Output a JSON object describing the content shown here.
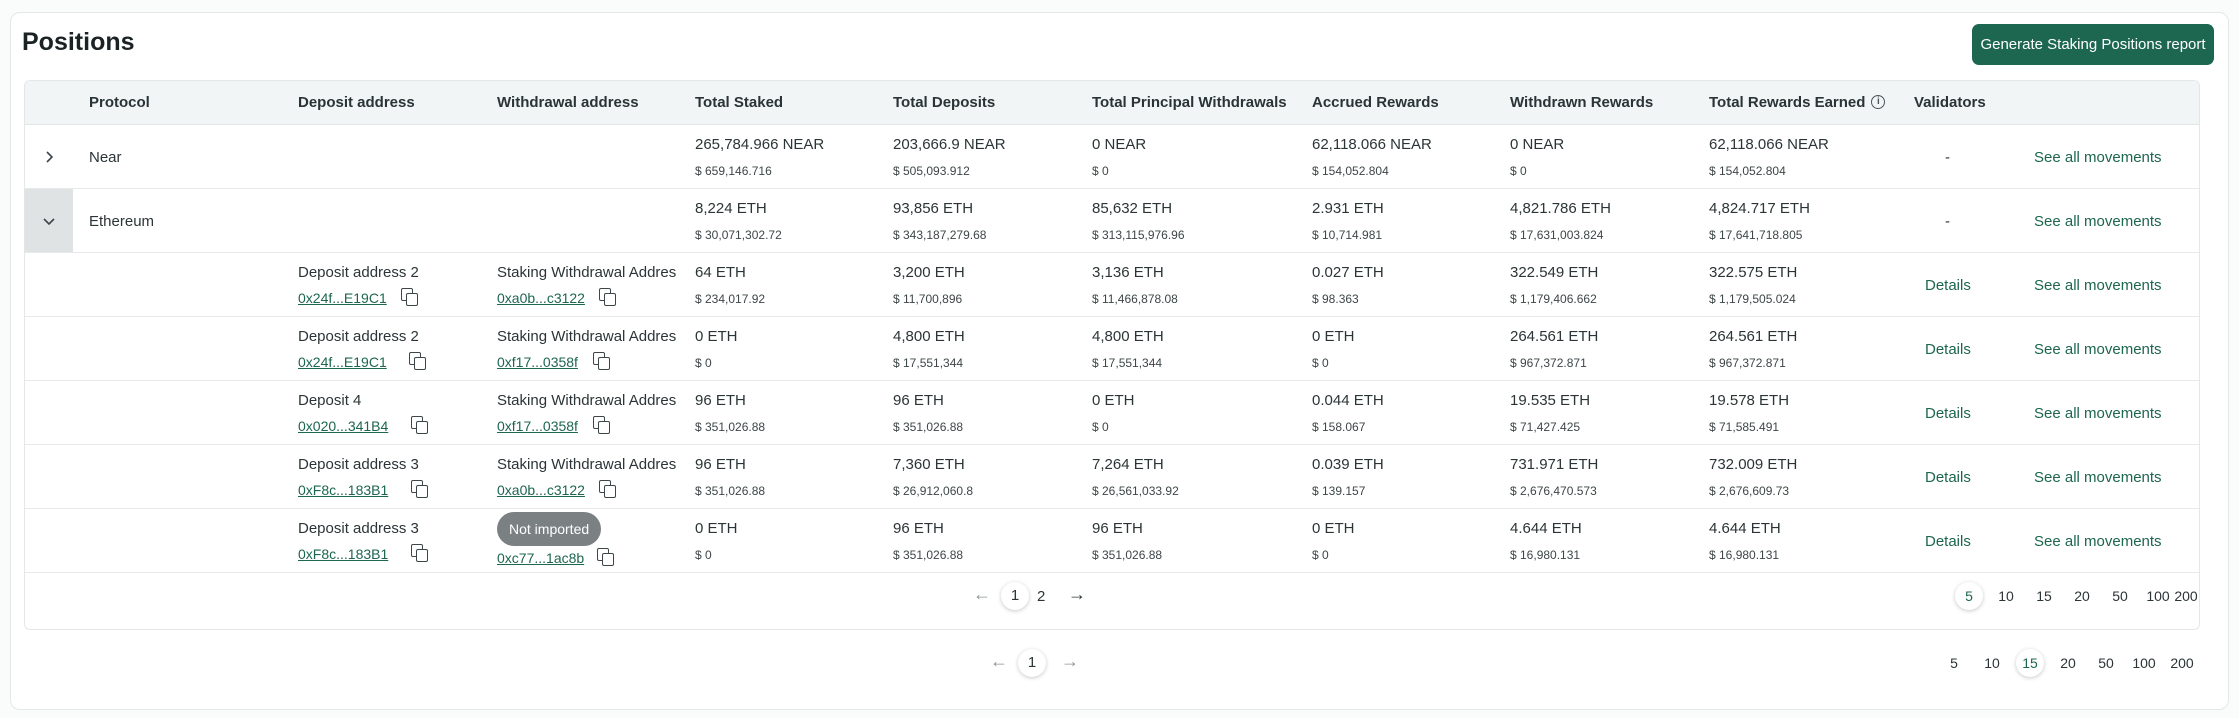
{
  "page": {
    "title": "Positions",
    "generate_button": "Generate Staking Positions report"
  },
  "columns": {
    "protocol": "Protocol",
    "deposit_address": "Deposit address",
    "withdrawal_address": "Withdrawal address",
    "total_staked": "Total Staked",
    "total_deposits": "Total Deposits",
    "total_principal_withdrawals": "Total Principal Withdrawals",
    "accrued_rewards": "Accrued Rewards",
    "withdrawn_rewards": "Withdrawn Rewards",
    "total_rewards_earned": "Total Rewards Earned",
    "validators": "Validators"
  },
  "protocols": [
    {
      "name": "Near",
      "expanded": false,
      "total_staked": "265,784.966 NEAR",
      "total_staked_usd": "$ 659,146.716",
      "total_deposits": "203,666.9 NEAR",
      "total_deposits_usd": "$ 505,093.912",
      "total_principal_withdrawals": "0 NEAR",
      "total_principal_withdrawals_usd": "$ 0",
      "accrued_rewards": "62,118.066 NEAR",
      "accrued_rewards_usd": "$ 154,052.804",
      "withdrawn_rewards": "0 NEAR",
      "withdrawn_rewards_usd": "$ 0",
      "total_rewards_earned": "62,118.066 NEAR",
      "total_rewards_earned_usd": "$ 154,052.804",
      "validators": "-",
      "movements_link": "See all movements"
    },
    {
      "name": "Ethereum",
      "expanded": true,
      "total_staked": "8,224 ETH",
      "total_staked_usd": "$ 30,071,302.72",
      "total_deposits": "93,856 ETH",
      "total_deposits_usd": "$ 343,187,279.68",
      "total_principal_withdrawals": "85,632 ETH",
      "total_principal_withdrawals_usd": "$ 313,115,976.96",
      "accrued_rewards": "2.931 ETH",
      "accrued_rewards_usd": "$ 10,714.981",
      "withdrawn_rewards": "4,821.786 ETH",
      "withdrawn_rewards_usd": "$ 17,631,003.824",
      "total_rewards_earned": "4,824.717 ETH",
      "total_rewards_earned_usd": "$ 17,641,718.805",
      "validators": "-",
      "movements_link": "See all movements"
    }
  ],
  "positions": [
    {
      "deposit_label": "Deposit address 2",
      "deposit_addr": "0x24f...E19C1",
      "withdrawal_label": "Staking Withdrawal Addres",
      "withdrawal_addr": "0xa0b...c3122",
      "total_staked": "64 ETH",
      "total_staked_usd": "$ 234,017.92",
      "total_deposits": "3,200 ETH",
      "total_deposits_usd": "$ 11,700,896",
      "total_principal_withdrawals": "3,136 ETH",
      "total_principal_withdrawals_usd": "$ 11,466,878.08",
      "accrued_rewards": "0.027 ETH",
      "accrued_rewards_usd": "$ 98.363",
      "withdrawn_rewards": "322.549 ETH",
      "withdrawn_rewards_usd": "$ 1,179,406.662",
      "total_rewards_earned": "322.575 ETH",
      "total_rewards_earned_usd": "$ 1,179,505.024",
      "validators_link": "Details",
      "movements_link": "See all movements"
    },
    {
      "deposit_label": "Deposit address 2",
      "deposit_addr": "0x24f...E19C1",
      "withdrawal_label": "Staking Withdrawal Addres",
      "withdrawal_addr": "0xf17...0358f",
      "total_staked": "0 ETH",
      "total_staked_usd": "$ 0",
      "total_deposits": "4,800 ETH",
      "total_deposits_usd": "$ 17,551,344",
      "total_principal_withdrawals": "4,800 ETH",
      "total_principal_withdrawals_usd": "$ 17,551,344",
      "accrued_rewards": "0 ETH",
      "accrued_rewards_usd": "$ 0",
      "withdrawn_rewards": "264.561 ETH",
      "withdrawn_rewards_usd": "$ 967,372.871",
      "total_rewards_earned": "264.561 ETH",
      "total_rewards_earned_usd": "$ 967,372.871",
      "validators_link": "Details",
      "movements_link": "See all movements"
    },
    {
      "deposit_label": "Deposit 4",
      "deposit_addr": "0x020...341B4",
      "withdrawal_label": "Staking Withdrawal Addres",
      "withdrawal_addr": "0xf17...0358f",
      "total_staked": "96 ETH",
      "total_staked_usd": "$ 351,026.88",
      "total_deposits": "96 ETH",
      "total_deposits_usd": "$ 351,026.88",
      "total_principal_withdrawals": "0 ETH",
      "total_principal_withdrawals_usd": "$ 0",
      "accrued_rewards": "0.044 ETH",
      "accrued_rewards_usd": "$ 158.067",
      "withdrawn_rewards": "19.535 ETH",
      "withdrawn_rewards_usd": "$ 71,427.425",
      "total_rewards_earned": "19.578 ETH",
      "total_rewards_earned_usd": "$ 71,585.491",
      "validators_link": "Details",
      "movements_link": "See all movements"
    },
    {
      "deposit_label": "Deposit address 3",
      "deposit_addr": "0xF8c...183B1",
      "withdrawal_label": "Staking Withdrawal Addres",
      "withdrawal_addr": "0xa0b...c3122",
      "total_staked": "96 ETH",
      "total_staked_usd": "$ 351,026.88",
      "total_deposits": "7,360 ETH",
      "total_deposits_usd": "$ 26,912,060.8",
      "total_principal_withdrawals": "7,264 ETH",
      "total_principal_withdrawals_usd": "$ 26,561,033.92",
      "accrued_rewards": "0.039 ETH",
      "accrued_rewards_usd": "$ 139.157",
      "withdrawn_rewards": "731.971 ETH",
      "withdrawn_rewards_usd": "$ 2,676,470.573",
      "total_rewards_earned": "732.009 ETH",
      "total_rewards_earned_usd": "$ 2,676,609.73",
      "validators_link": "Details",
      "movements_link": "See all movements"
    },
    {
      "deposit_label": "Deposit address 3",
      "deposit_addr": "0xF8c...183B1",
      "withdrawal_badge": "Not imported",
      "withdrawal_addr": "0xc77...1ac8b",
      "total_staked": "0 ETH",
      "total_staked_usd": "$ 0",
      "total_deposits": "96 ETH",
      "total_deposits_usd": "$ 351,026.88",
      "total_principal_withdrawals": "96 ETH",
      "total_principal_withdrawals_usd": "$ 351,026.88",
      "accrued_rewards": "0 ETH",
      "accrued_rewards_usd": "$ 0",
      "withdrawn_rewards": "4.644 ETH",
      "withdrawn_rewards_usd": "$ 16,980.131",
      "total_rewards_earned": "4.644 ETH",
      "total_rewards_earned_usd": "$ 16,980.131",
      "validators_link": "Details",
      "movements_link": "See all movements"
    }
  ],
  "inner_pagination": {
    "pages": [
      "1",
      "2"
    ],
    "current": "1",
    "page_sizes": [
      "5",
      "10",
      "15",
      "20",
      "50",
      "100",
      "200"
    ],
    "selected_size": "5"
  },
  "outer_pagination": {
    "pages": [
      "1"
    ],
    "current": "1",
    "page_sizes": [
      "5",
      "10",
      "15",
      "20",
      "50",
      "100",
      "200"
    ],
    "selected_size": "15"
  }
}
